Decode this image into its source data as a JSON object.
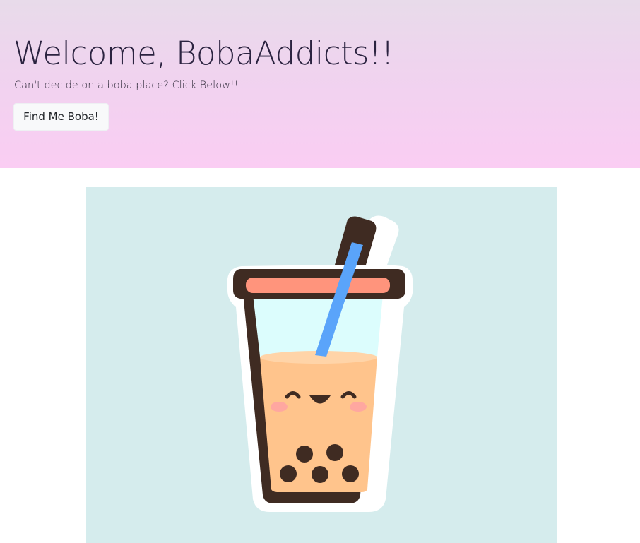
{
  "hero": {
    "title": "Welcome, BobaAddicts!!",
    "subtitle": "Can't decide on a boba place? Click Below!!",
    "button_label": "Find Me Boba!"
  },
  "illustration": {
    "icon": "boba-tea-cup-icon",
    "colors": {
      "background": "#d5eced",
      "outline": "#3f2b22",
      "lid": "#ff947c",
      "tea": "#ffc48c",
      "glass": "#dcfdfd",
      "straw": "#5aa4fa",
      "blush": "#ffa7a0"
    }
  }
}
